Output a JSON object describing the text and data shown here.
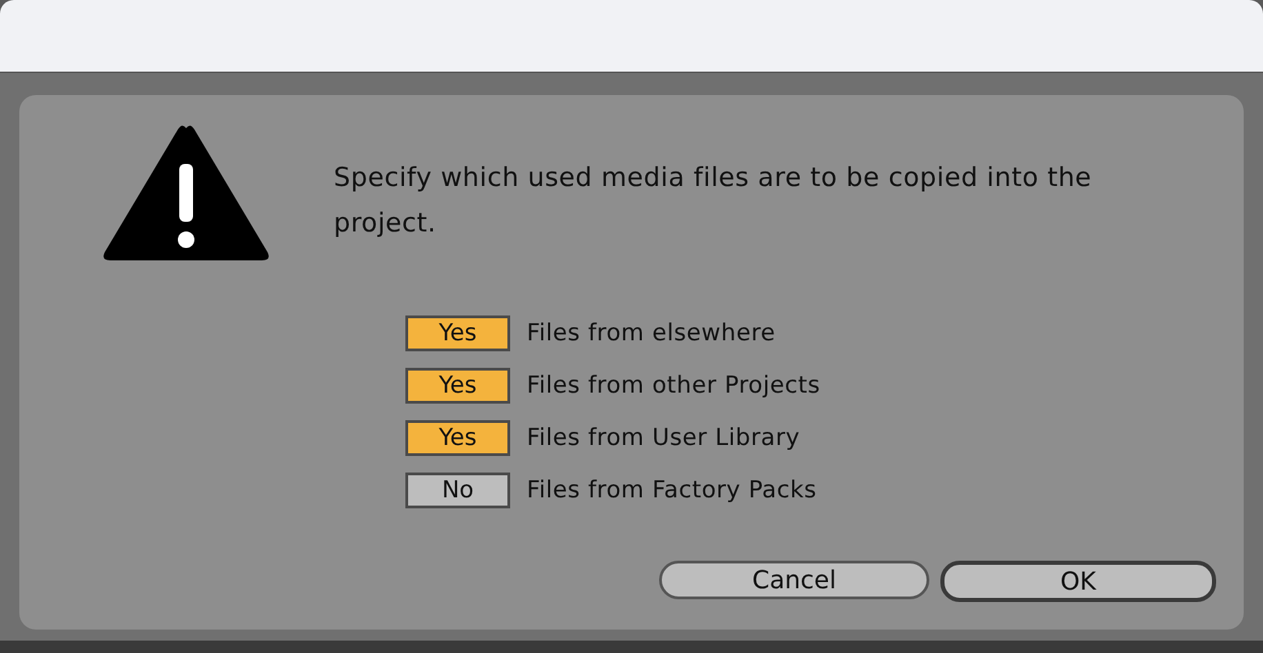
{
  "dialog": {
    "message": "Specify which used media files are to be copied into the project.",
    "options": [
      {
        "state": "Yes",
        "on": true,
        "label": "Files from elsewhere"
      },
      {
        "state": "Yes",
        "on": true,
        "label": "Files from other Projects"
      },
      {
        "state": "Yes",
        "on": true,
        "label": "Files from User Library"
      },
      {
        "state": "No",
        "on": false,
        "label": "Files from Factory Packs"
      }
    ],
    "buttons": [
      {
        "label": "Cancel",
        "default": false
      },
      {
        "label": "OK",
        "default": true
      }
    ]
  }
}
